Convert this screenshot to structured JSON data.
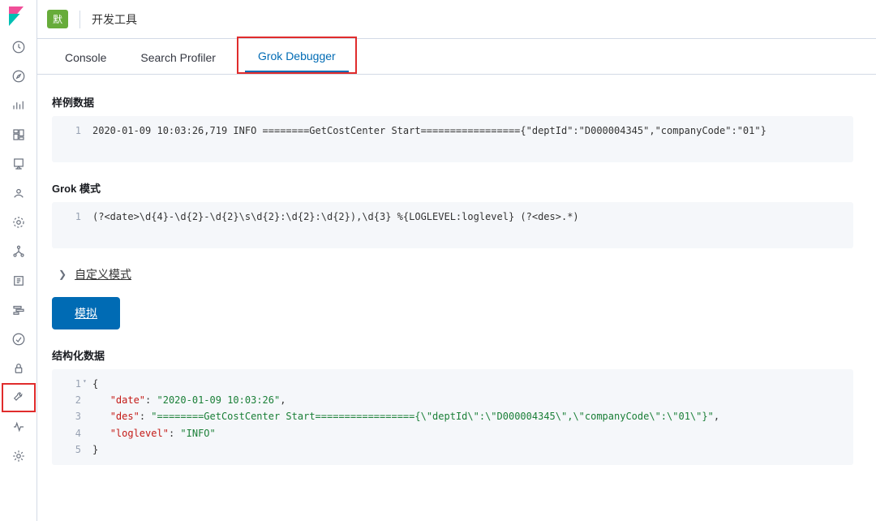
{
  "header": {
    "badge": "默",
    "title": "开发工具"
  },
  "tabs": {
    "console": "Console",
    "profiler": "Search Profiler",
    "grok": "Grok Debugger",
    "active": "grok"
  },
  "sample": {
    "label": "样例数据",
    "line": "2020-01-09 10:03:26,719 INFO ========GetCostCenter Start================={\"deptId\":\"D000004345\",\"companyCode\":\"01\"}"
  },
  "pattern": {
    "label": "Grok 模式",
    "line": "(?<date>\\d{4}-\\d{2}-\\d{2}\\s\\d{2}:\\d{2}:\\d{2}),\\d{3} %{LOGLEVEL:loglevel} (?<des>.*)"
  },
  "custom": {
    "label": "自定义模式"
  },
  "simulate": {
    "label": "模拟"
  },
  "output": {
    "label": "结构化数据",
    "json": {
      "date_key": "\"date\"",
      "date_val": "\"2020-01-09 10:03:26\"",
      "des_key": "\"des\"",
      "des_val": "\"========GetCostCenter Start================={\\\"deptId\\\":\\\"D000004345\\\",\\\"companyCode\\\":\\\"01\\\"}\"",
      "loglevel_key": "\"loglevel\"",
      "loglevel_val": "\"INFO\""
    }
  }
}
